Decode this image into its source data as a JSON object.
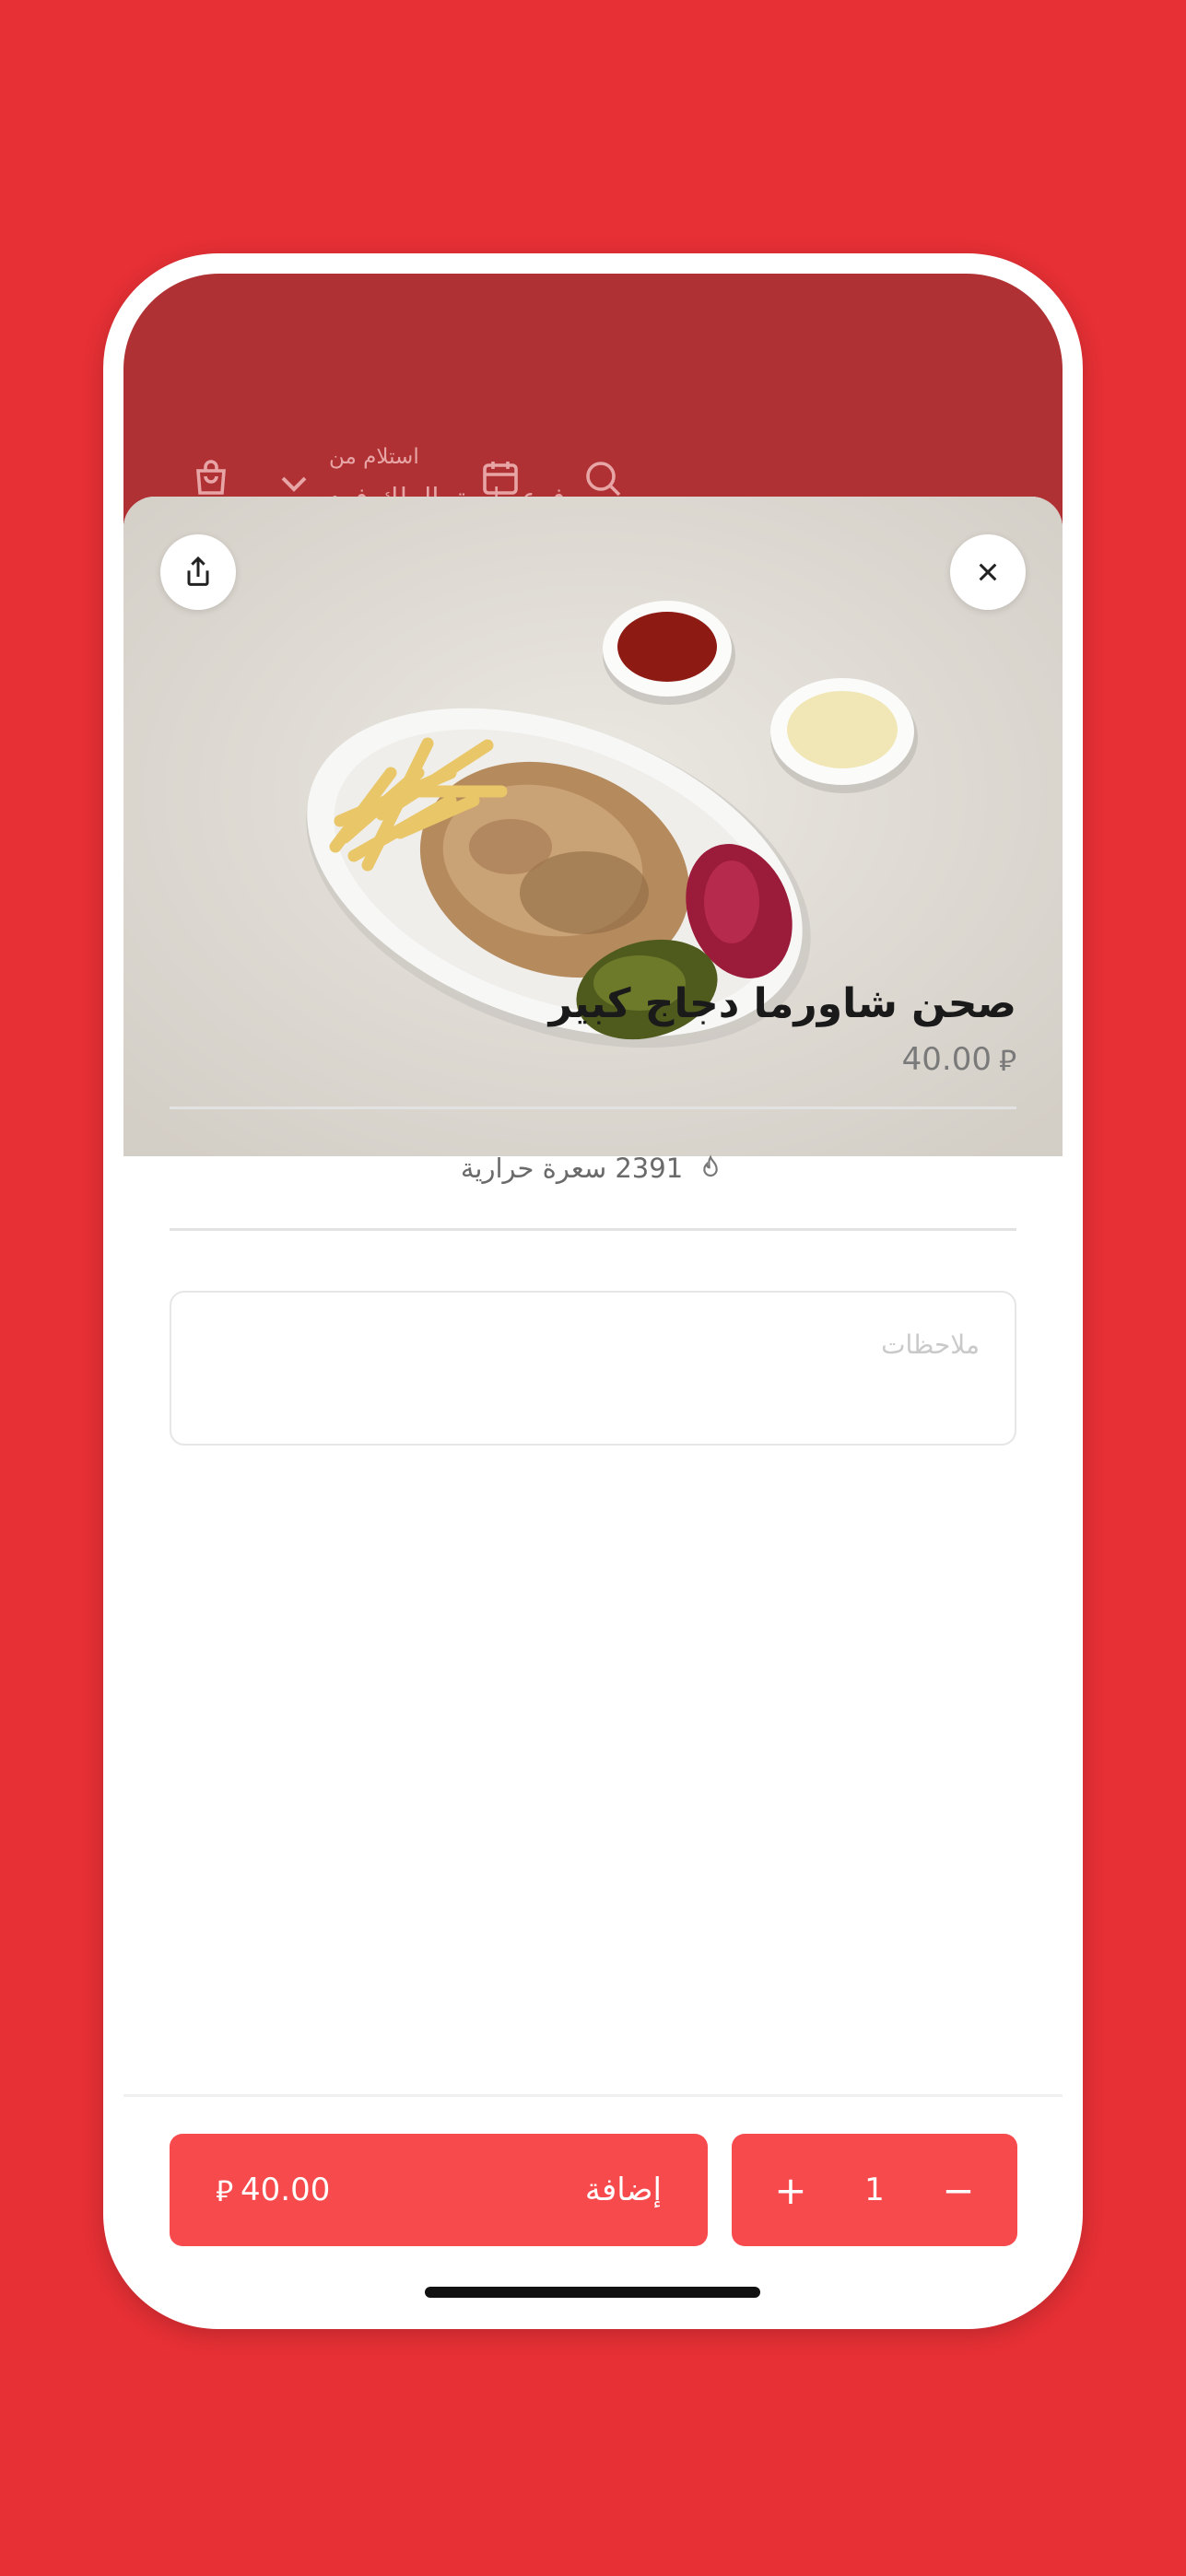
{
  "header": {
    "pickup_label": "استلام من",
    "branch_name": "فرع طريق الملك فهد"
  },
  "product": {
    "title": "صحن شاورما دجاج كبير",
    "price": "40.00",
    "currency_symbol": "⃁",
    "calories": "2391 سعرة حرارية"
  },
  "notes": {
    "placeholder": "ملاحظات",
    "value": ""
  },
  "cart_bar": {
    "add_label": "إضافة",
    "total": "40.00",
    "quantity": "1",
    "increment_symbol": "+",
    "decrement_symbol": "−"
  },
  "colors": {
    "background": "#E63035",
    "accent": "#F74A4D",
    "header_dimmed": "#AF3134"
  }
}
